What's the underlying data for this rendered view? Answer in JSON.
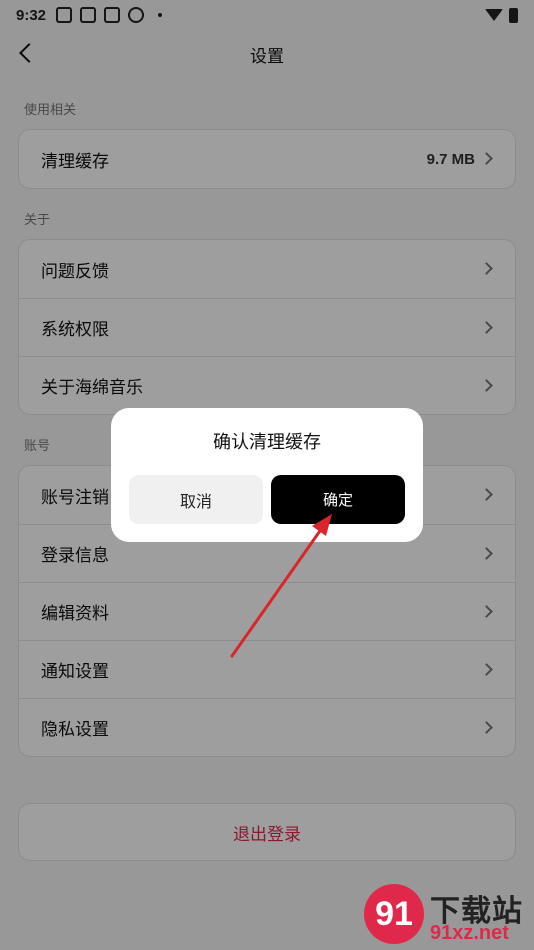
{
  "status_bar": {
    "time": "9:32"
  },
  "header": {
    "title": "设置"
  },
  "sections": {
    "usage": {
      "label": "使用相关",
      "items": [
        {
          "label": "清理缓存",
          "value": "9.7 MB"
        }
      ]
    },
    "about": {
      "label": "关于",
      "items": [
        {
          "label": "问题反馈"
        },
        {
          "label": "系统权限"
        },
        {
          "label": "关于海绵音乐"
        }
      ]
    },
    "account": {
      "label": "账号",
      "items": [
        {
          "label": "账号注销"
        },
        {
          "label": "登录信息"
        },
        {
          "label": "编辑资料"
        },
        {
          "label": "通知设置"
        },
        {
          "label": "隐私设置"
        }
      ]
    }
  },
  "logout": {
    "label": "退出登录"
  },
  "dialog": {
    "title": "确认清理缓存",
    "cancel_label": "取消",
    "confirm_label": "确定"
  },
  "watermark": {
    "logo_text": "91",
    "site_cn": "下载站",
    "site_url": "91xz.net"
  },
  "colors": {
    "accent": "#e0284b",
    "confirm_bg": "#000000",
    "annotation_arrow": "#d8262a"
  }
}
